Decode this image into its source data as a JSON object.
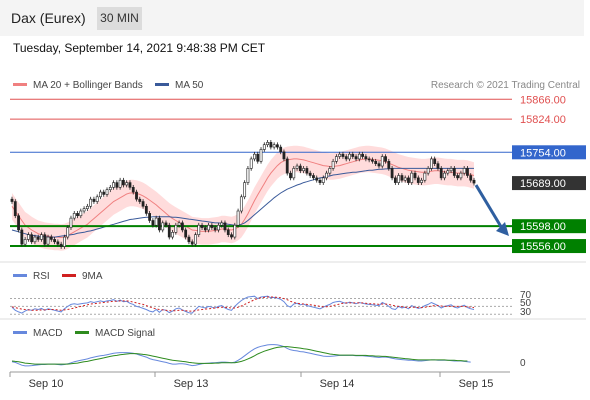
{
  "header": {
    "title": "Dax (Eurex)",
    "timeframe": "30 MIN"
  },
  "timestamp": "Tuesday, September 14, 2021 9:48:38 PM CET",
  "legend": {
    "bb_label": "MA 20 + Bollinger Bands",
    "ma50_label": "MA 50",
    "copyright": "Research © 2021 Trading Central"
  },
  "colors": {
    "resistance": "#e05050",
    "pivot": "#3366cc",
    "support": "#008000",
    "last": "#333333",
    "bollinger": "#ffd6d6",
    "ma20": "#f08080",
    "ma50": "#3a5a9a",
    "arrow": "#2f5fa0",
    "rsi": "#6688dd",
    "rsi_ma": "#d02020",
    "macd": "#6688dd",
    "macd_signal": "#2e8b1e"
  },
  "rsi_panel": {
    "label": "RSI",
    "ma_label": "9MA",
    "levels": [
      "70",
      "50",
      "30"
    ]
  },
  "macd_panel": {
    "label": "MACD",
    "signal_label": "MACD Signal",
    "zero": "0"
  },
  "chart_data": {
    "type": "candlestick",
    "title": "Dax (Eurex)",
    "timeframe": "30 MIN",
    "ylim": [
      15535,
      15875
    ],
    "x_labels": [
      "Sep 10",
      "Sep 13",
      "Sep 14",
      "Sep 15"
    ],
    "price_levels": [
      {
        "label": "15866.00",
        "value": 15866,
        "kind": "resistance"
      },
      {
        "label": "15824.00",
        "value": 15824,
        "kind": "resistance"
      },
      {
        "label": "15754.00",
        "value": 15754,
        "kind": "pivot"
      },
      {
        "label": "15689.00",
        "value": 15689,
        "kind": "last"
      },
      {
        "label": "15598.00",
        "value": 15598,
        "kind": "support"
      },
      {
        "label": "15556.00",
        "value": 15556,
        "kind": "support"
      }
    ],
    "close": [
      15650,
      15620,
      15590,
      15560,
      15570,
      15580,
      15565,
      15575,
      15570,
      15580,
      15560,
      15575,
      15570,
      15565,
      15560,
      15555,
      15575,
      15595,
      15615,
      15625,
      15620,
      15630,
      15635,
      15640,
      15655,
      15650,
      15660,
      15670,
      15665,
      15675,
      15680,
      15690,
      15680,
      15695,
      15685,
      15690,
      15680,
      15670,
      15655,
      15650,
      15640,
      15625,
      15610,
      15600,
      15615,
      15590,
      15605,
      15600,
      15575,
      15585,
      15600,
      15605,
      15590,
      15575,
      15565,
      15560,
      15580,
      15600,
      15595,
      15590,
      15600,
      15595,
      15590,
      15600,
      15605,
      15590,
      15580,
      15575,
      15600,
      15630,
      15660,
      15690,
      15720,
      15740,
      15750,
      15735,
      15760,
      15770,
      15775,
      15765,
      15770,
      15765,
      15755,
      15740,
      15710,
      15700,
      15720,
      15725,
      15715,
      15720,
      15710,
      15705,
      15700,
      15695,
      15690,
      15700,
      15710,
      15720,
      15735,
      15745,
      15750,
      15745,
      15740,
      15750,
      15745,
      15740,
      15750,
      15745,
      15740,
      15738,
      15735,
      15730,
      15725,
      15745,
      15735,
      15720,
      15700,
      15690,
      15705,
      15695,
      15700,
      15690,
      15710,
      15700,
      15690,
      15695,
      15710,
      15720,
      15740,
      15730,
      15720,
      15700,
      15710,
      15715,
      15720,
      15705,
      15700,
      15710,
      15720,
      15705,
      15695,
      15689
    ],
    "ma20": [
      15640,
      15630,
      15620,
      15610,
      15600,
      15595,
      15590,
      15586,
      15582,
      15580,
      15578,
      15577,
      15576,
      15575,
      15575,
      15574,
      15575,
      15578,
      15582,
      15586,
      15590,
      15594,
      15598,
      15602,
      15608,
      15614,
      15620,
      15626,
      15632,
      15638,
      15644,
      15650,
      15654,
      15658,
      15662,
      15666,
      15668,
      15668,
      15667,
      15665,
      15662,
      15658,
      15653,
      15648,
      15643,
      15637,
      15631,
      15625,
      15619,
      15614,
      15610,
      15606,
      15602,
      15598,
      15594,
      15590,
      15589,
      15588,
      15587,
      15587,
      15587,
      15588,
      15589,
      15590,
      15592,
      15592,
      15591,
      15590,
      15592,
      15596,
      15602,
      15612,
      15624,
      15638,
      15652,
      15664,
      15676,
      15688,
      15700,
      15710,
      15718,
      15726,
      15732,
      15736,
      15738,
      15739,
      15740,
      15740,
      15739,
      15738,
      15736,
      15734,
      15732,
      15730,
      15728,
      15726,
      15725,
      15724,
      15724,
      15725,
      15726,
      15728,
      15730,
      15732,
      15734,
      15736,
      15738,
      15739,
      15740,
      15740,
      15739,
      15738,
      15737,
      15736,
      15734,
      15731,
      15728,
      15725,
      15722,
      15720,
      15718,
      15716,
      15715,
      15714,
      15713,
      15712,
      15712,
      15713,
      15714,
      15715,
      15715,
      15714,
      15713,
      15712,
      15712,
      15711,
      15710,
      15710,
      15710,
      15709,
      15707,
      15705
    ],
    "ma50": [
      15590,
      15588,
      15586,
      15584,
      15582,
      15580,
      15579,
      15578,
      15577,
      15576,
      15576,
      15575,
      15575,
      15575,
      15576,
      15577,
      15578,
      15579,
      15580,
      15581,
      15583,
      15584,
      15585,
      15587,
      15588,
      15590,
      15592,
      15594,
      15596,
      15598,
      15600,
      15602,
      15604,
      15606,
      15608,
      15610,
      15612,
      15613,
      15614,
      15615,
      15616,
      15617,
      15617,
      15618,
      15618,
      15618,
      15618,
      15618,
      15618,
      15617,
      15617,
      15616,
      15615,
      15614,
      15613,
      15612,
      15611,
      15610,
      15609,
      15608,
      15607,
      15606,
      15605,
      15605,
      15604,
      15603,
      15602,
      15601,
      15600,
      15600,
      15602,
      15605,
      15610,
      15616,
      15622,
      15628,
      15634,
      15640,
      15646,
      15652,
      15658,
      15663,
      15668,
      15672,
      15676,
      15679,
      15682,
      15685,
      15687,
      15690,
      15692,
      15694,
      15696,
      15698,
      15700,
      15701,
      15703,
      15704,
      15706,
      15707,
      15708,
      15709,
      15710,
      15711,
      15712,
      15712,
      15713,
      15714,
      15715,
      15716,
      15716,
      15717,
      15718,
      15718,
      15719,
      15719,
      15720,
      15720,
      15720,
      15720,
      15720,
      15720,
      15720,
      15720,
      15720,
      15720,
      15720,
      15720,
      15720,
      15720,
      15720,
      15720,
      15720,
      15720,
      15720,
      15720,
      15720,
      15720,
      15720,
      15720,
      15720,
      15720
    ],
    "rsi": [
      48,
      40,
      36,
      33,
      38,
      42,
      40,
      44,
      42,
      45,
      40,
      44,
      42,
      40,
      38,
      36,
      44,
      50,
      55,
      57,
      55,
      57,
      58,
      59,
      62,
      60,
      62,
      64,
      62,
      64,
      65,
      67,
      63,
      66,
      62,
      63,
      58,
      55,
      50,
      48,
      45,
      42,
      38,
      36,
      42,
      35,
      42,
      40,
      34,
      38,
      44,
      46,
      41,
      37,
      34,
      33,
      42,
      50,
      48,
      46,
      50,
      48,
      46,
      50,
      52,
      46,
      42,
      40,
      50,
      58,
      65,
      70,
      74,
      75,
      76,
      70,
      74,
      75,
      76,
      72,
      73,
      71,
      68,
      62,
      52,
      48,
      56,
      58,
      54,
      56,
      52,
      50,
      48,
      46,
      44,
      48,
      52,
      55,
      60,
      62,
      63,
      60,
      58,
      61,
      59,
      57,
      60,
      58,
      56,
      55,
      54,
      53,
      52,
      60,
      56,
      50,
      44,
      42,
      50,
      46,
      48,
      44,
      52,
      48,
      45,
      47,
      52,
      55,
      60,
      56,
      52,
      46,
      50,
      52,
      54,
      48,
      46,
      50,
      53,
      47,
      44,
      42
    ],
    "rsi_ma": [
      49,
      47,
      45,
      43,
      42,
      41,
      40,
      40,
      40,
      41,
      41,
      42,
      42,
      42,
      41,
      40,
      41,
      42,
      44,
      46,
      48,
      50,
      52,
      54,
      56,
      57,
      58,
      59,
      60,
      61,
      62,
      63,
      63,
      64,
      64,
      64,
      63,
      61,
      59,
      57,
      55,
      52,
      49,
      46,
      44,
      42,
      41,
      40,
      39,
      39,
      39,
      40,
      40,
      39,
      38,
      38,
      39,
      41,
      42,
      43,
      44,
      45,
      46,
      47,
      48,
      48,
      47,
      46,
      46,
      48,
      51,
      55,
      59,
      63,
      67,
      70,
      72,
      73,
      74,
      74,
      74,
      73,
      72,
      70,
      67,
      63,
      60,
      58,
      57,
      56,
      55,
      54,
      53,
      52,
      50,
      49,
      49,
      50,
      52,
      54,
      56,
      58,
      59,
      59,
      59,
      59,
      59,
      59,
      58,
      57,
      57,
      56,
      55,
      56,
      56,
      55,
      53,
      51,
      50,
      49,
      48,
      47,
      48,
      48,
      47,
      47,
      48,
      49,
      51,
      52,
      52,
      51,
      50,
      50,
      50,
      50,
      50,
      50,
      50,
      49,
      48,
      47
    ],
    "macd": [
      -2,
      -4,
      -8,
      -12,
      -14,
      -14,
      -13,
      -12,
      -11,
      -10,
      -10,
      -9,
      -9,
      -9,
      -10,
      -11,
      -10,
      -8,
      -5,
      -2,
      0,
      2,
      4,
      6,
      9,
      11,
      13,
      15,
      16,
      18,
      20,
      22,
      23,
      24,
      24,
      24,
      23,
      22,
      20,
      17,
      14,
      11,
      7,
      4,
      2,
      0,
      -2,
      -4,
      -7,
      -9,
      -9,
      -8,
      -8,
      -9,
      -11,
      -13,
      -12,
      -10,
      -8,
      -7,
      -6,
      -5,
      -5,
      -4,
      -3,
      -3,
      -4,
      -5,
      -3,
      2,
      8,
      15,
      22,
      29,
      35,
      39,
      42,
      44,
      46,
      47,
      47,
      46,
      44,
      41,
      36,
      32,
      30,
      29,
      27,
      26,
      24,
      22,
      20,
      18,
      16,
      14,
      13,
      13,
      14,
      15,
      16,
      16,
      16,
      16,
      16,
      15,
      15,
      15,
      14,
      13,
      12,
      11,
      10,
      11,
      11,
      10,
      8,
      6,
      5,
      4,
      3,
      2,
      2,
      1,
      0,
      0,
      1,
      2,
      3,
      3,
      2,
      2,
      2,
      2,
      1,
      0,
      0,
      0,
      -1,
      -2,
      -3
    ],
    "macd_signal": [
      0,
      -1,
      -2,
      -4,
      -6,
      -7,
      -8,
      -9,
      -9,
      -9,
      -9,
      -9,
      -9,
      -9,
      -9,
      -9,
      -9,
      -9,
      -8,
      -7,
      -6,
      -4,
      -2,
      -1,
      1,
      3,
      5,
      7,
      9,
      11,
      13,
      15,
      16,
      18,
      19,
      20,
      21,
      21,
      21,
      20,
      19,
      18,
      16,
      14,
      12,
      10,
      8,
      6,
      4,
      2,
      1,
      0,
      -1,
      -2,
      -4,
      -5,
      -6,
      -7,
      -7,
      -7,
      -7,
      -7,
      -6,
      -6,
      -5,
      -5,
      -5,
      -5,
      -5,
      -3,
      -1,
      2,
      6,
      10,
      15,
      20,
      24,
      28,
      31,
      34,
      37,
      39,
      40,
      41,
      41,
      40,
      39,
      38,
      37,
      35,
      34,
      32,
      30,
      28,
      26,
      24,
      22,
      20,
      19,
      18,
      17,
      17,
      17,
      17,
      17,
      16,
      16,
      16,
      16,
      15,
      15,
      14,
      14,
      13,
      13,
      12,
      11,
      10,
      9,
      8,
      7,
      6,
      5,
      4,
      3,
      3,
      3,
      3,
      3,
      3,
      3,
      3,
      3,
      2,
      2,
      2,
      1,
      1,
      0,
      0
    ]
  }
}
